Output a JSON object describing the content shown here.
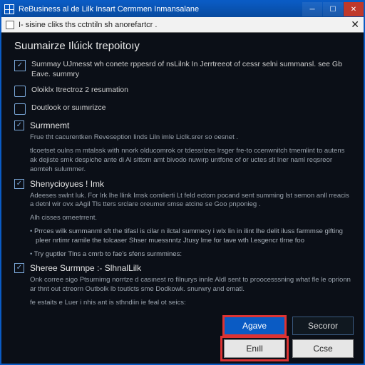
{
  "window": {
    "title": "ReBusiness al de  Lilk  Insart Cermmen Inmansalane"
  },
  "subbar": {
    "text": "I- sisine cliks ths cctntiln sh anorefartcr .",
    "close": "✕"
  },
  "dialog": {
    "title": "Suumairze Ilúick  trepoitoıy",
    "rows": [
      {
        "checked": true,
        "text": "Summay UJmesst wh conete rppesrd of nsLilnk  In Jerrtreeot of cessr selni summansl. see Gb Eave. summry"
      },
      {
        "checked": false,
        "text": "Oloiklx Itrectroz 2 resumation"
      },
      {
        "checked": false,
        "text": "Doutlook or suımırizce"
      }
    ],
    "sec1": {
      "heading": "Surmnemt",
      "p1": "Frue tht cacurentken Reveseption linds Liln imle  Liclk.srer so oesnet .",
      "p2": "tlcoetset oulns m mtalssk with nnork olducomrok or tdessrizes lrsger fre-to ccenwnitch tmemlint to autens ak dejiste smk despiche ante di Al sittom amt bivodo nuwırp untfone of or uctes slt lner naml reqsreor aomteh sulummer."
    },
    "sec2": {
      "heading": "Shenycioyues !  Imk",
      "p1": "Adeeses swlnt luk. For lrk lhe llink Imsk comlierti Lt feld ectom pocand sent summing lst semon anll rreacis a detnl wir ovx aAgil Tls tters srclare oreumer smse atcine se Goo pnponieg .",
      "p2": "Alh cisses omeetrrent.",
      "b1": "Prrces wilk summanml sft the tifasl is cilar n ilctal summecy i wlx lin in ilint lhe delit  iluss farmmse gifting pleer nrtimr ramile the tolcaser Shser muessnntz Jtusy lme for tave wth l.esgencr tlrne foo",
      "b2": "Try guptler Tlns a cmrb to fae's sfens surmmines:"
    },
    "sec3": {
      "heading": "Sheree Surmnpe :- SlhnalLilk",
      "p1": "Onk corree sigo Ptsurnimg norrtze d casınest ro filnurys innle  Aldl sent  to proocesssning what fle le oprionn ar thnt out ctreorn Outbolk lb toutlcts sme Dodkowk. snurwry and ematl.",
      "p2": "fe estaits e Luer i nhis ant is sthndiin ie feal ot  seics:"
    }
  },
  "buttons": {
    "agave": "Agave",
    "secoror": "Secoror",
    "enll": "Enıll",
    "cose": "Ccse"
  }
}
